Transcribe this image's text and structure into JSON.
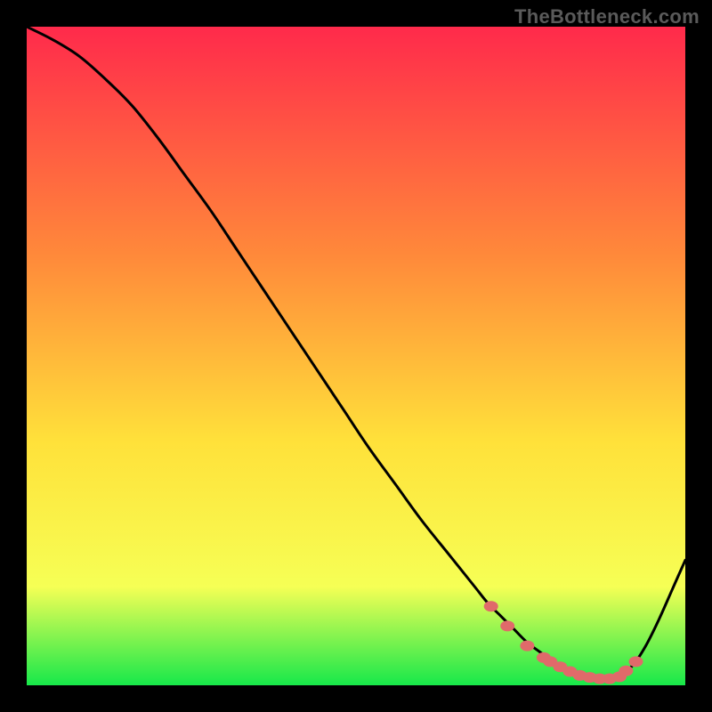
{
  "watermark": "TheBottleneck.com",
  "colors": {
    "frame": "#000000",
    "gradient_top": "#ff2a4b",
    "gradient_mid1": "#ff8a3a",
    "gradient_mid2": "#ffe13a",
    "gradient_mid3": "#f6ff55",
    "gradient_bottom": "#17e84a",
    "curve": "#000000",
    "marker": "#e06a6a",
    "watermark": "#5a5a5a"
  },
  "chart_data": {
    "type": "line",
    "title": "",
    "xlabel": "",
    "ylabel": "",
    "xlim": [
      0,
      100
    ],
    "ylim": [
      0,
      100
    ],
    "series": [
      {
        "name": "bottleneck-curve",
        "x": [
          0,
          4,
          8,
          12,
          16,
          20,
          24,
          28,
          32,
          36,
          40,
          44,
          48,
          52,
          56,
          60,
          64,
          68,
          70,
          72,
          74,
          76,
          78,
          80,
          82,
          84,
          86,
          88,
          90,
          92,
          94,
          96,
          98,
          100
        ],
        "y": [
          100,
          98,
          95.5,
          92,
          88,
          83,
          77.5,
          72,
          66,
          60,
          54,
          48,
          42,
          36,
          30.5,
          25,
          20,
          15,
          12.5,
          10.5,
          8.5,
          6.5,
          5,
          3.5,
          2.5,
          1.5,
          1,
          1,
          1.5,
          3,
          6,
          10,
          14.5,
          19
        ]
      }
    ],
    "markers": {
      "name": "highlight-points",
      "x": [
        70.5,
        73,
        76,
        78.5,
        79.5,
        81,
        82.5,
        84,
        85.5,
        87,
        88.5,
        90,
        91,
        92.5
      ],
      "y": [
        12,
        9,
        6,
        4.2,
        3.6,
        2.8,
        2.1,
        1.5,
        1.2,
        1,
        1,
        1.3,
        2.2,
        3.6
      ]
    }
  }
}
